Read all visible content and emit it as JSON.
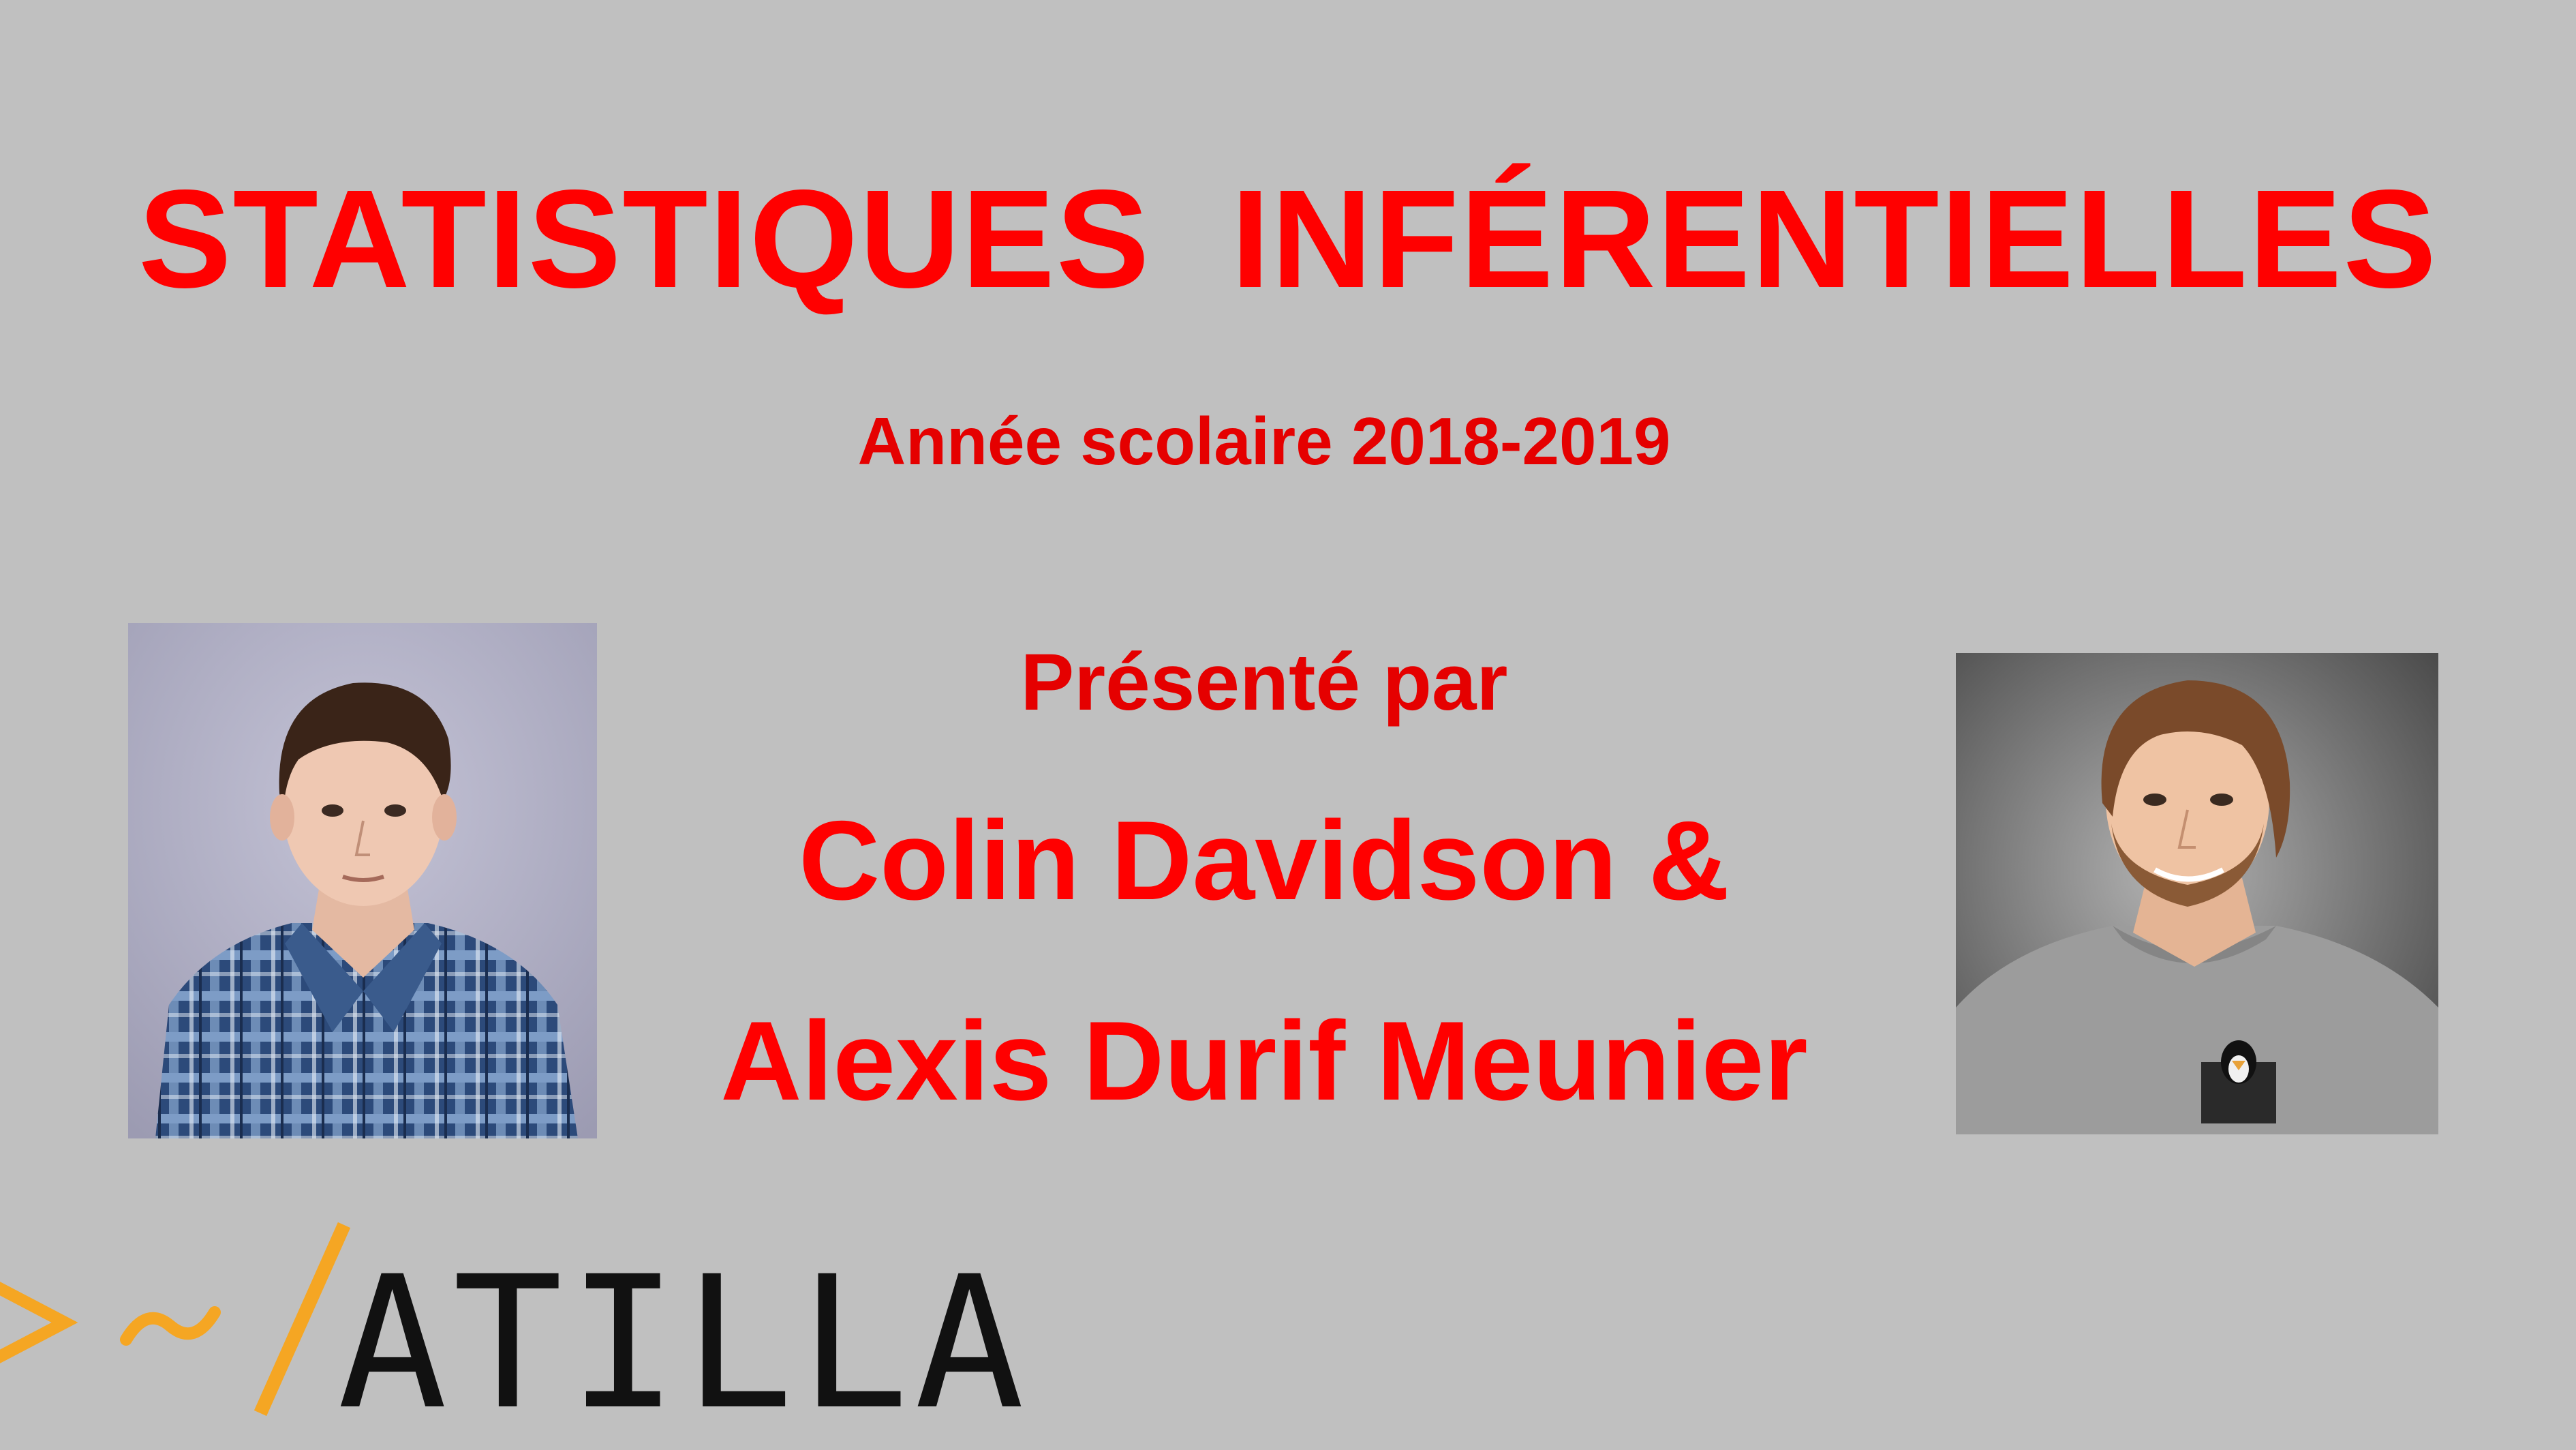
{
  "slide": {
    "title": "STATISTIQUES  INFÉRENTIELLES",
    "subtitle": "Année scolaire 2018-2019",
    "presented_by": "Présenté par",
    "author_line_1": "Colin Davidson &",
    "author_line_2": "Alexis Durif Meunier"
  },
  "logo": {
    "text": "ATILLA",
    "symbol": ">~/",
    "symbol_color": "#f5a623",
    "text_color": "#111111"
  },
  "colors": {
    "background": "#c0c0c0",
    "accent_red": "#ff0000"
  }
}
